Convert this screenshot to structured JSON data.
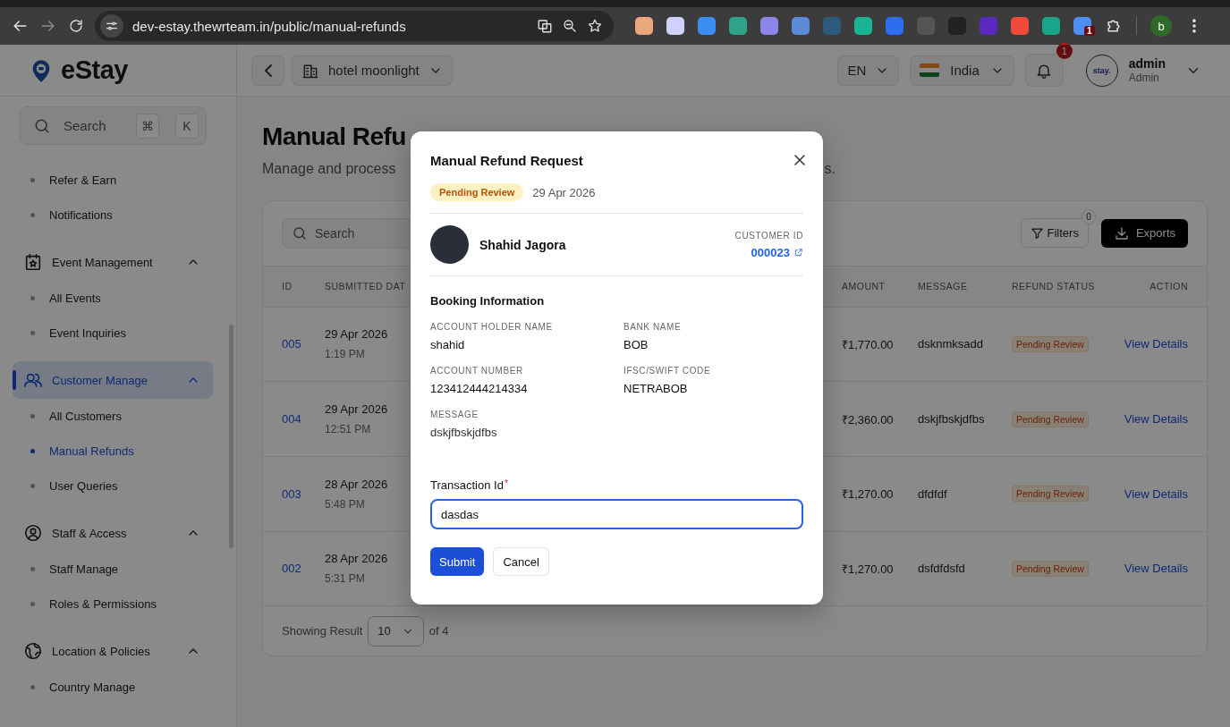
{
  "browser": {
    "url": "dev-estay.thewrteam.in/public/manual-refunds",
    "extension_badge": "1",
    "profile_initial": "b"
  },
  "sidebar": {
    "logo": "eStay",
    "search": {
      "placeholder": "Search",
      "shortcut": [
        "⌘",
        "K"
      ]
    },
    "items": [
      {
        "kind": "link",
        "label": "Refer & Earn",
        "selected": false
      },
      {
        "kind": "link",
        "label": "Notifications",
        "selected": false
      },
      {
        "kind": "group",
        "label": "Event Management",
        "selected": false,
        "expanded": true,
        "children": [
          {
            "kind": "link",
            "label": "All Events",
            "selected": false
          },
          {
            "kind": "link",
            "label": "Event Inquiries",
            "selected": false
          }
        ]
      },
      {
        "kind": "group",
        "label": "Customer Manage",
        "selected": true,
        "expanded": true,
        "children": [
          {
            "kind": "link",
            "label": "All Customers",
            "selected": false
          },
          {
            "kind": "link",
            "label": "Manual Refunds",
            "selected": true
          },
          {
            "kind": "link",
            "label": "User Queries",
            "selected": false
          }
        ]
      },
      {
        "kind": "group",
        "label": "Staff & Access",
        "selected": false,
        "expanded": true,
        "children": [
          {
            "kind": "link",
            "label": "Staff Manage",
            "selected": false
          },
          {
            "kind": "link",
            "label": "Roles & Permissions",
            "selected": false
          }
        ]
      },
      {
        "kind": "group",
        "label": "Location & Policies",
        "selected": false,
        "expanded": true,
        "children": [
          {
            "kind": "link",
            "label": "Country Manage",
            "selected": false
          }
        ]
      }
    ]
  },
  "topbar": {
    "hotel": "hotel moonlight",
    "language": "EN",
    "country": "India",
    "notification_count": "1",
    "user": {
      "logo": "stay.",
      "name": "admin",
      "role": "Admin"
    }
  },
  "page": {
    "title": "Manual Refu",
    "subtitle": "Manage and process",
    "subtitle_tail": "s.",
    "search": {
      "placeholder": "Search"
    },
    "filters": {
      "label": "Filters",
      "count": "0"
    },
    "exports": "Exports",
    "table": {
      "columns": [
        "ID",
        "SUBMITTED DAT",
        "AMOUNT",
        "MESSAGE",
        "REFUND STATUS",
        "ACTION"
      ],
      "rows": [
        {
          "id": "005",
          "date": "29 Apr 2026",
          "time": "1:19 PM",
          "amount": "₹1,770.00",
          "message": "dsknmksadd",
          "status": "Pending Review",
          "action": "View Details"
        },
        {
          "id": "004",
          "date": "29 Apr 2026",
          "time": "12:51 PM",
          "amount": "₹2,360.00",
          "message": "dskjfbskjdfbs",
          "status": "Pending Review",
          "action": "View Details"
        },
        {
          "id": "003",
          "date": "28 Apr 2026",
          "time": "5:48 PM",
          "amount": "₹1,270.00",
          "message": "dfdfdf",
          "status": "Pending Review",
          "action": "View Details"
        },
        {
          "id": "002",
          "date": "28 Apr 2026",
          "time": "5:31 PM",
          "amount": "₹1,270.00",
          "message": "dsfdfdsfd",
          "status": "Pending Review",
          "action": "View Details"
        }
      ]
    },
    "footer": {
      "label": "Showing Result",
      "page_size": "10",
      "total": "of 4"
    }
  },
  "modal": {
    "title": "Manual Refund Request",
    "status": "Pending Review",
    "date": "29 Apr 2026",
    "customer": {
      "name": "Shahid Jagora",
      "id_label": "CUSTOMER ID",
      "id": "000023"
    },
    "section": "Booking Information",
    "fields": [
      {
        "label": "ACCOUNT HOLDER NAME",
        "value": "shahid"
      },
      {
        "label": "BANK NAME",
        "value": "BOB"
      },
      {
        "label": "ACCOUNT NUMBER",
        "value": "123412444214334"
      },
      {
        "label": "IFSC/SWIFT CODE",
        "value": "NETRABOB"
      },
      {
        "label": "MESSAGE",
        "value": "dskjfbskjdfbs"
      }
    ],
    "transaction": {
      "label": "Transaction Id",
      "required_mark": "*",
      "value": "dasdas"
    },
    "buttons": [
      {
        "kind": "primary",
        "label": "Submit"
      },
      {
        "kind": "secondary",
        "label": "Cancel"
      }
    ]
  }
}
